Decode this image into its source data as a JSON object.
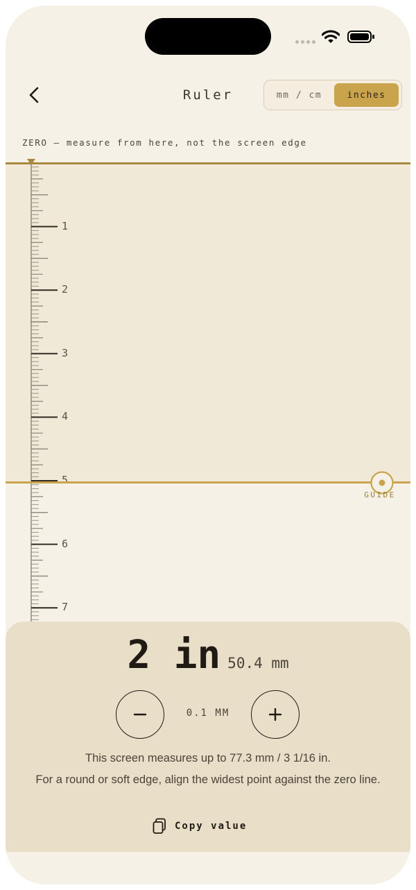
{
  "header": {
    "title": "Ruler",
    "units": [
      {
        "label": "mm / cm",
        "active": false
      },
      {
        "label": "inches",
        "active": true
      }
    ]
  },
  "zero_caption": "ZERO — measure from here, not the screen edge",
  "ruler": {
    "unit": "inches",
    "labels": [
      "1",
      "2",
      "3",
      "4",
      "5",
      "6",
      "7"
    ],
    "subdivisions_per_unit": 16
  },
  "guide": {
    "label": "GUIDE",
    "position_in": 5
  },
  "readout": {
    "value": "2 in",
    "secondary": "50.4 mm"
  },
  "stepper": {
    "step_label": "0.1 MM"
  },
  "info": {
    "range": "This screen measures up to 77.3 mm / 3 1/16 in.",
    "tip": "For a round or soft edge, align the widest point against the zero line."
  },
  "copy": {
    "label": "Copy value"
  },
  "colors": {
    "background": "#f6f1e6",
    "accent": "#c9a44c",
    "panel": "#e9dec8",
    "text": "#1f1a14"
  }
}
